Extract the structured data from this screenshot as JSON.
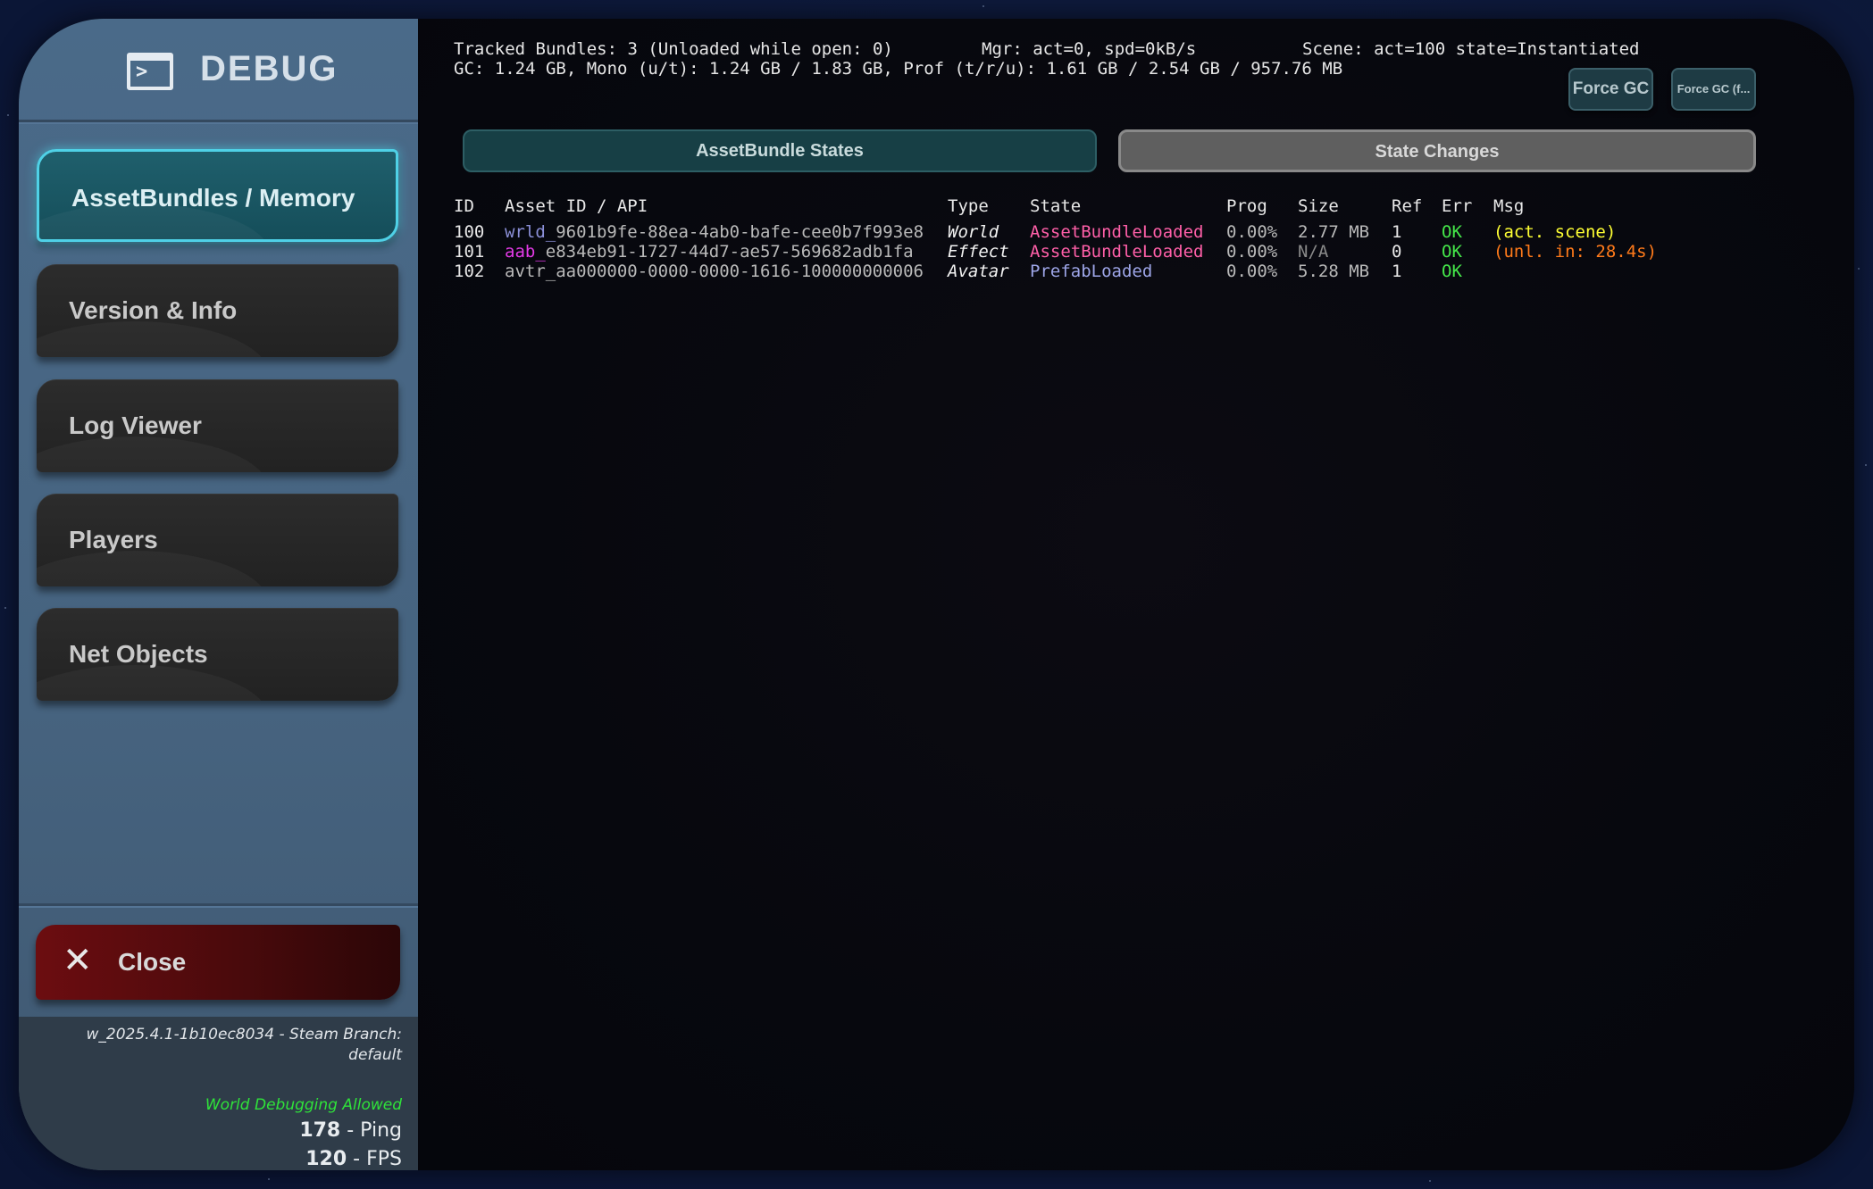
{
  "sidebar": {
    "title": "DEBUG",
    "nav": [
      {
        "label": "AssetBundles / Memory",
        "active": true
      },
      {
        "label": "Version & Info",
        "active": false
      },
      {
        "label": "Log Viewer",
        "active": false
      },
      {
        "label": "Players",
        "active": false
      },
      {
        "label": "Net Objects",
        "active": false
      }
    ],
    "close_label": "Close",
    "build": "w_2025.4.1-1b10ec8034 - Steam Branch: default",
    "world_debugging": "World Debugging Allowed",
    "ping_value": "178",
    "ping_label": "- Ping",
    "fps_value": "120",
    "fps_label": "- FPS"
  },
  "stats": {
    "tracked": "Tracked Bundles: 3 (Unloaded while open: 0)",
    "mgr": "Mgr: act=0, spd=0kB/s",
    "scene": "Scene: act=100 state=Instantiated",
    "gc": "GC: 1.24 GB, Mono (u/t): 1.24 GB / 1.83 GB, Prof (t/r/u): 1.61 GB / 2.54 GB / 957.76 MB"
  },
  "buttons": {
    "force_gc": "Force GC",
    "force_gc_full": "Force GC (f..."
  },
  "tabs": [
    {
      "label": "AssetBundle States",
      "active": true
    },
    {
      "label": "State Changes",
      "active": false
    }
  ],
  "table": {
    "headers": {
      "id": "ID",
      "asset": "Asset ID / API",
      "type": "Type",
      "state": "State",
      "prog": "Prog",
      "size": "Size",
      "ref": "Ref",
      "err": "Err",
      "msg": "Msg"
    },
    "rows": [
      {
        "id": "100",
        "prefix": "wrld_",
        "guid": "9601b9fe-88ea-4ab0-bafe-cee0b7f993e8",
        "type": "World",
        "state": "AssetBundleLoaded",
        "prog": "0.00%",
        "size": "2.77 MB",
        "ref": "1",
        "err": "OK",
        "msg": "(act. scene)"
      },
      {
        "id": "101",
        "prefix": "aab_",
        "guid": "e834eb91-1727-44d7-ae57-569682adb1fa",
        "type": "Effect",
        "state": "AssetBundleLoaded",
        "prog": "0.00%",
        "size": "N/A",
        "ref": "0",
        "err": "OK",
        "msg": "(unl. in: 28.4s)"
      },
      {
        "id": "102",
        "prefix": "",
        "guid": "avtr_aa000000-0000-0000-1616-100000000006",
        "type": "Avatar",
        "state": "PrefabLoaded",
        "prog": "0.00%",
        "size": "5.28 MB",
        "ref": "1",
        "err": "OK",
        "msg": ""
      }
    ]
  },
  "colors": {
    "prefix_world": "#8b90d8",
    "prefix_effect": "#e23ae6",
    "guid": "#b9b9b9",
    "state_bundle": "#ff5fa8",
    "state_prefab": "#9ea6e8",
    "msg_scene": "#ffff33",
    "msg_unload": "#ff7a1a",
    "ok": "#45e84a"
  }
}
